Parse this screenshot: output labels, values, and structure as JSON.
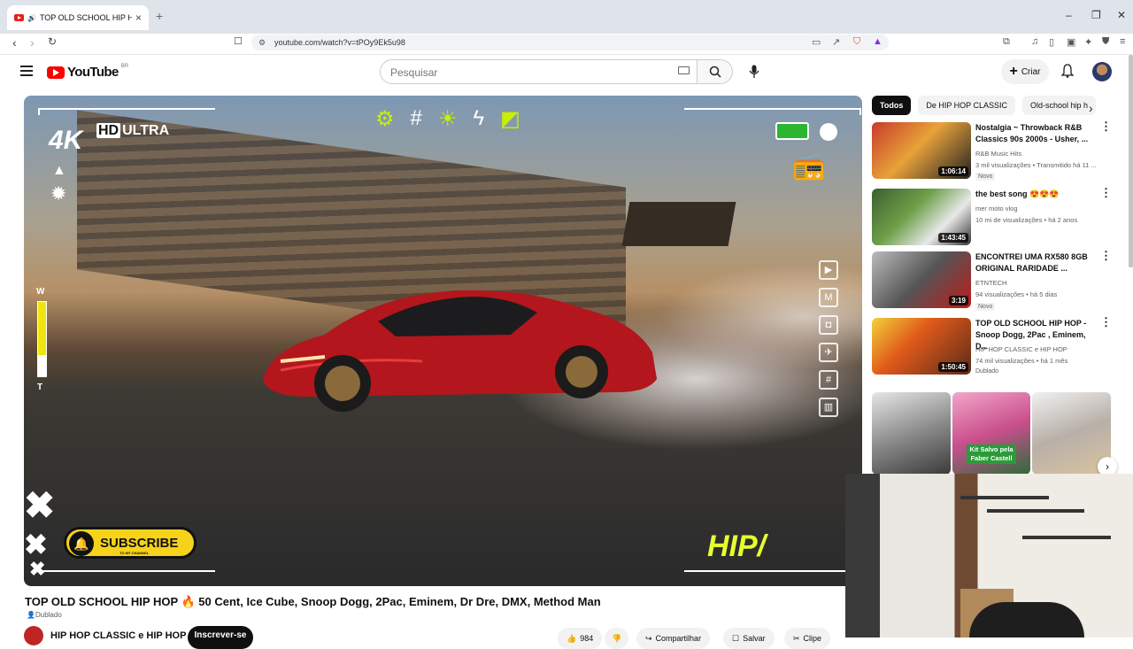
{
  "browser": {
    "tab_title": "TOP OLD SCHOOL HIP HOP",
    "new_tab": "+",
    "close_tab": "×",
    "url": "youtube.com/watch?v=tPOy9Ek5u98",
    "window_controls": [
      "–",
      "❐",
      "✕"
    ]
  },
  "header": {
    "logo_text": "YouTube",
    "country_code": "BR",
    "search_placeholder": "Pesquisar",
    "create_label": "Criar"
  },
  "player": {
    "badge_4k": "4K",
    "badge_hd": "HD",
    "badge_ultra": "ULTRA",
    "w_label": "W",
    "t_label": "T",
    "subscribe_label": "SUBSCRIBE",
    "subscribe_sub": "TO MY CHANNEL",
    "logo_text": "HIP/"
  },
  "video": {
    "title": "TOP OLD SCHOOL HIP HOP 🔥 50 Cent, Ice Cube, Snoop Dogg, 2Pac, Eminem, Dr Dre, DMX, Method Man",
    "dubbed": "Dublado",
    "channel": "HIP HOP CLASSIC e HIP HOP",
    "subscribe_button": "Inscrever-se",
    "likes": "984",
    "share": "Compartilhar",
    "save": "Salvar",
    "clip": "Clipe"
  },
  "chips": [
    "Todos",
    "De HIP HOP CLASSIC",
    "Old-school hip h"
  ],
  "recommendations": [
    {
      "title": "Nostalgia ~ Throwback R&B Classics 90s 2000s - Usher, ...",
      "channel": "R&B Music Hits",
      "meta": "3 mil visualizações • Transmitido há 11 ...",
      "badge": "Novo",
      "duration": "1:06:14"
    },
    {
      "title": "the best song 😍😍😍",
      "channel": "mer moto vlog",
      "meta": "10 mi de visualizações • há 2 anos",
      "badge": "",
      "duration": "1:43:45"
    },
    {
      "title": "ENCONTREI UMA RX580 8GB ORIGINAL RARIDADE ...",
      "channel": "ETNTECH",
      "meta": "94 visualizações • há 5 dias",
      "badge": "Novo",
      "duration": "3:19"
    },
    {
      "title": "TOP OLD SCHOOL HIP HOP - Snoop Dogg, 2Pac , Eminem, D...",
      "channel": "HIP HOP CLASSIC e HIP HOP",
      "meta": "74 mil visualizações • há 1 mês",
      "badge": "Dublado",
      "duration": "1:50:45"
    }
  ],
  "shorts": {
    "label": "Kit Salvo pela Faber Castell"
  },
  "colors": {
    "youtube_red": "#ff0000",
    "chip_active": "#0f0f0f",
    "subscribe_yellow": "#f7d21a",
    "overlay_lime": "#c8f000"
  }
}
